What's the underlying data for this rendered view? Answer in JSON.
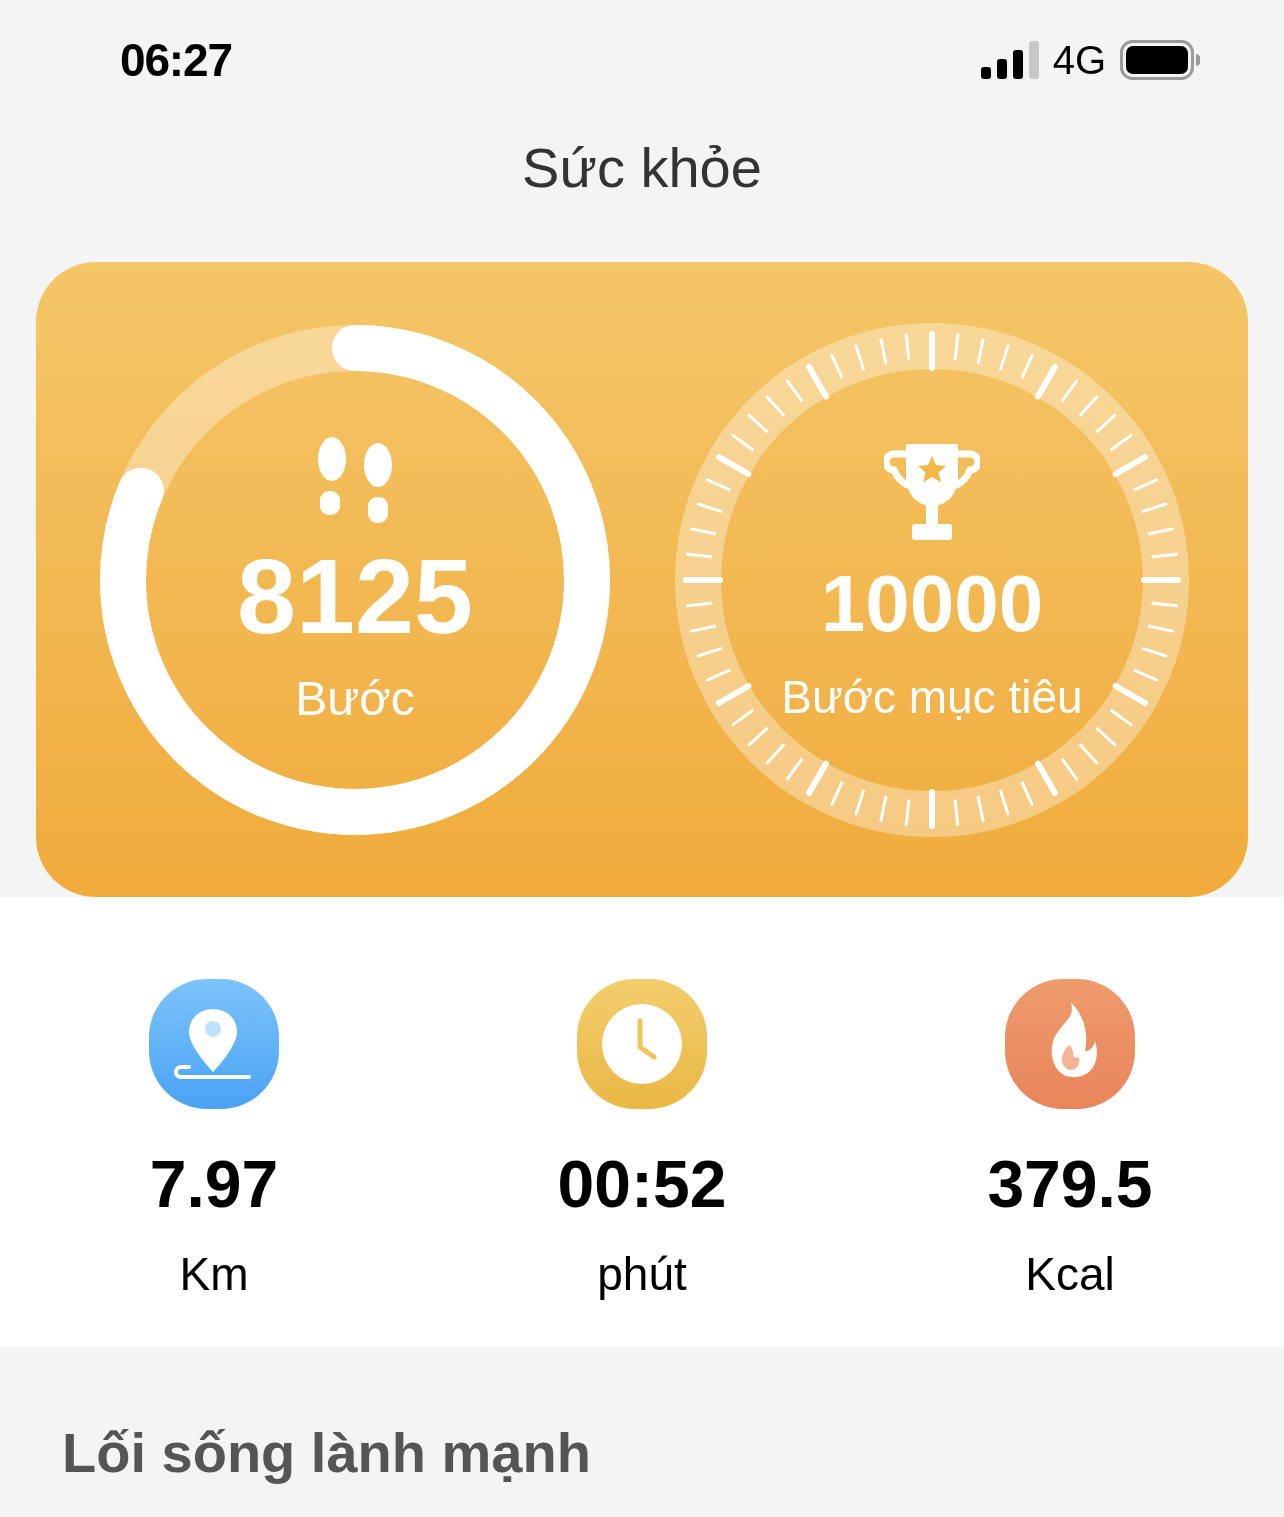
{
  "status_bar": {
    "time": "06:27",
    "network": "4G"
  },
  "title": "Sức khỏe",
  "steps": {
    "value": "8125",
    "label": "Bước"
  },
  "goal": {
    "value": "10000",
    "label": "Bước mục tiêu"
  },
  "stats": [
    {
      "kind": "distance",
      "value": "7.97",
      "unit": "Km"
    },
    {
      "kind": "duration",
      "value": "00:52",
      "unit": "phút"
    },
    {
      "kind": "calories",
      "value": "379.5",
      "unit": "Kcal"
    }
  ],
  "section_heading": "Lối sống lành mạnh"
}
